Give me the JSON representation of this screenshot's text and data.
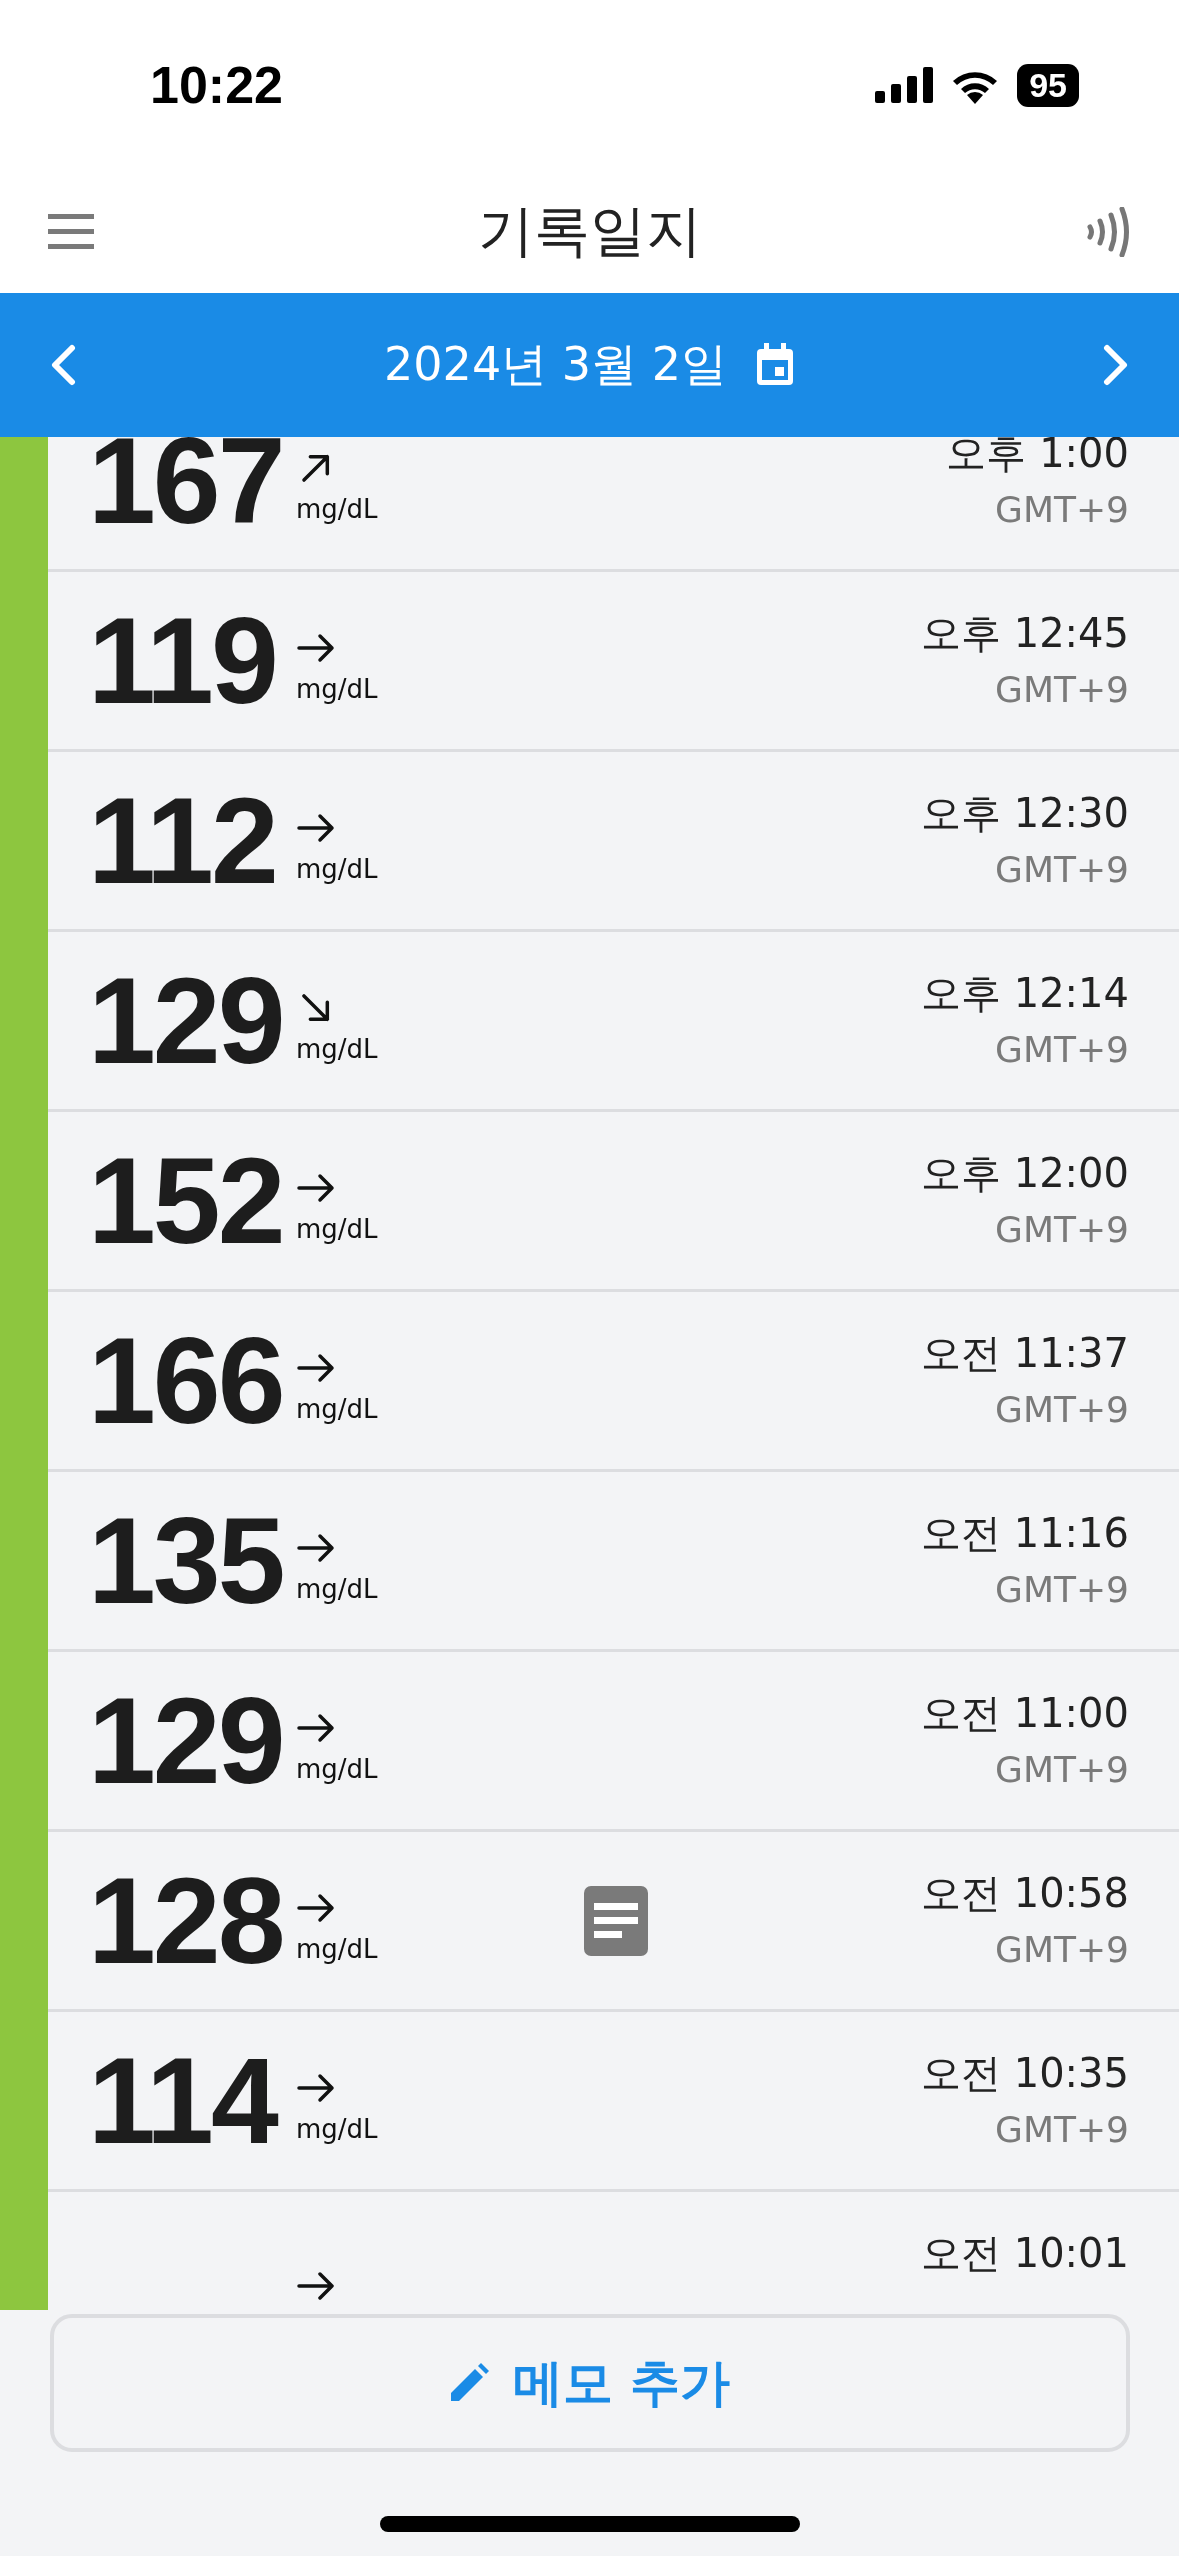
{
  "status_bar": {
    "time": "10:22",
    "battery": "95"
  },
  "header": {
    "title": "기록일지"
  },
  "date_bar": {
    "date": "2024년 3월 2일"
  },
  "readings": [
    {
      "value": "167",
      "kind": "rising",
      "unit": "mg/dL",
      "time": "오후 1:00",
      "zone": "GMT+9",
      "note": false
    },
    {
      "value": "119",
      "kind": "steady",
      "unit": "mg/dL",
      "time": "오후 12:45",
      "zone": "GMT+9",
      "note": false
    },
    {
      "value": "112",
      "kind": "steady",
      "unit": "mg/dL",
      "time": "오후 12:30",
      "zone": "GMT+9",
      "note": false
    },
    {
      "value": "129",
      "kind": "falling",
      "unit": "mg/dL",
      "time": "오후 12:14",
      "zone": "GMT+9",
      "note": false
    },
    {
      "value": "152",
      "kind": "steady",
      "unit": "mg/dL",
      "time": "오후 12:00",
      "zone": "GMT+9",
      "note": false
    },
    {
      "value": "166",
      "kind": "steady",
      "unit": "mg/dL",
      "time": "오전 11:37",
      "zone": "GMT+9",
      "note": false
    },
    {
      "value": "135",
      "kind": "steady",
      "unit": "mg/dL",
      "time": "오전 11:16",
      "zone": "GMT+9",
      "note": false
    },
    {
      "value": "129",
      "kind": "steady",
      "unit": "mg/dL",
      "time": "오전 11:00",
      "zone": "GMT+9",
      "note": false
    },
    {
      "value": "128",
      "kind": "steady",
      "unit": "mg/dL",
      "time": "오전 10:58",
      "zone": "GMT+9",
      "note": true
    },
    {
      "value": "114",
      "kind": "steady",
      "unit": "mg/dL",
      "time": "오전 10:35",
      "zone": "GMT+9",
      "note": false
    },
    {
      "kind": "steady",
      "time": "오전 10:01",
      "note": false
    }
  ],
  "add_note_button": {
    "label": "메모 추가"
  }
}
